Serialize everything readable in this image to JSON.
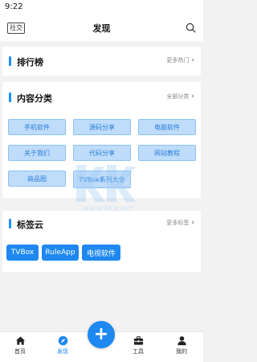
{
  "status_bar": {
    "time": "9:22"
  },
  "header": {
    "social_tag": "社交",
    "title": "发现"
  },
  "ranking": {
    "title": "排行榜",
    "more": "更多热门"
  },
  "categories": {
    "title": "内容分类",
    "more": "全部分类",
    "items": [
      "手机软件",
      "源码分享",
      "电脑软件",
      "关于我们",
      "代码分享",
      "网站教程",
      "商品图",
      "TVBox系列大全"
    ]
  },
  "tags": {
    "title": "标签云",
    "more": "更多标签",
    "items": [
      "TVBox",
      "RuleApp",
      "电视软件"
    ]
  },
  "watermark": {
    "text": "www.kkx.net"
  },
  "tabbar": {
    "items": [
      "首页",
      "发现",
      "工具",
      "我的"
    ],
    "active": "发现"
  },
  "colors": {
    "accent": "#1e88f0",
    "category_bg": "#bfdcfb"
  },
  "icons": [
    "search-icon",
    "home-icon",
    "compass-icon",
    "plus-icon",
    "toolbox-icon",
    "user-icon"
  ]
}
